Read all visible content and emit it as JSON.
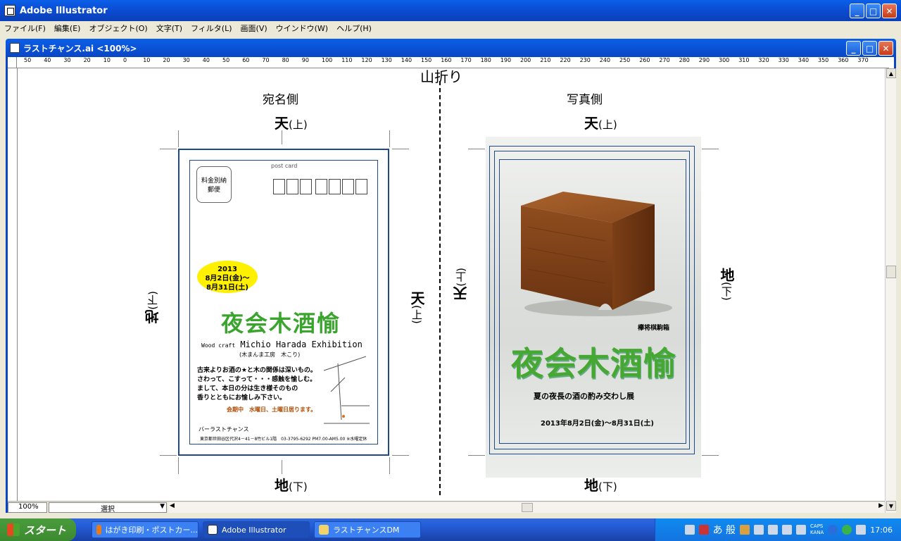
{
  "window": {
    "title": "Adobe Illustrator"
  },
  "menu": [
    "ファイル(F)",
    "編集(E)",
    "オブジェクト(O)",
    "文字(T)",
    "フィルタ(L)",
    "画面(V)",
    "ウインドウ(W)",
    "ヘルプ(H)"
  ],
  "document": {
    "title": "ラストチャンス.ai <100%>"
  },
  "ruler": [
    "50",
    "40",
    "30",
    "20",
    "10",
    "0",
    "10",
    "20",
    "30",
    "40",
    "50",
    "60",
    "70",
    "80",
    "90",
    "100",
    "110",
    "120",
    "130",
    "140",
    "150",
    "160",
    "170",
    "180",
    "190",
    "200",
    "210",
    "220",
    "230",
    "240",
    "250",
    "260",
    "270",
    "280",
    "290",
    "300",
    "310",
    "320",
    "330",
    "340",
    "350",
    "360",
    "370"
  ],
  "canvas": {
    "fold_label": "山折り",
    "left_side": "宛名側",
    "right_side": "写真側",
    "top_label": "天",
    "top_sub": "(上)",
    "bottom_label": "地",
    "bottom_sub": "(下)"
  },
  "front_card": {
    "stamp": "料金別納\n郵便",
    "postcard": "post card",
    "date_year": "2013",
    "date_line1": "8月2日(金)～",
    "date_line2": "8月31日(土)",
    "title": "夜会木酒愉",
    "wood_craft": "Wood craft",
    "exhibition": "Michio Harada Exhibition",
    "sub": "(木まんま工房　木こり)",
    "body": "古来よりお酒の★と木の関係は深いもの。\nさわって、こすって・・・感触を愉しむ。\nまして、本日の分は生き様そのもの\n香りとともにお愉しみ下さい。",
    "notice": "会期中　水曜日、土曜日居ります。",
    "shop": "バーラストチャンス",
    "address": "東京都世田谷区代沢4－41－8竹ビル1階　03-3795-6292 PM7.00-AM5.00 ※水曜定休"
  },
  "back_card": {
    "box_name": "欅将棋駒箱",
    "title": "夜会木酒愉",
    "subtitle": "夏の夜長の酒の酌み交わし展",
    "date": "2013年8月2日(金)～8月31日(土)"
  },
  "status": {
    "zoom": "100%",
    "tool": "選択"
  },
  "taskbar": {
    "start": "スタート",
    "items": [
      "はがき印刷・ポストカー...",
      "Adobe Illustrator",
      "ラストチャンスDM"
    ],
    "tray_ime": "あ 般",
    "caps": "CAPS",
    "kana": "KANA",
    "time": "17:06"
  },
  "colors": {
    "accent": "#0a5fe8",
    "title_green": "#3aa42e",
    "border_blue": "#1e4a8c"
  }
}
